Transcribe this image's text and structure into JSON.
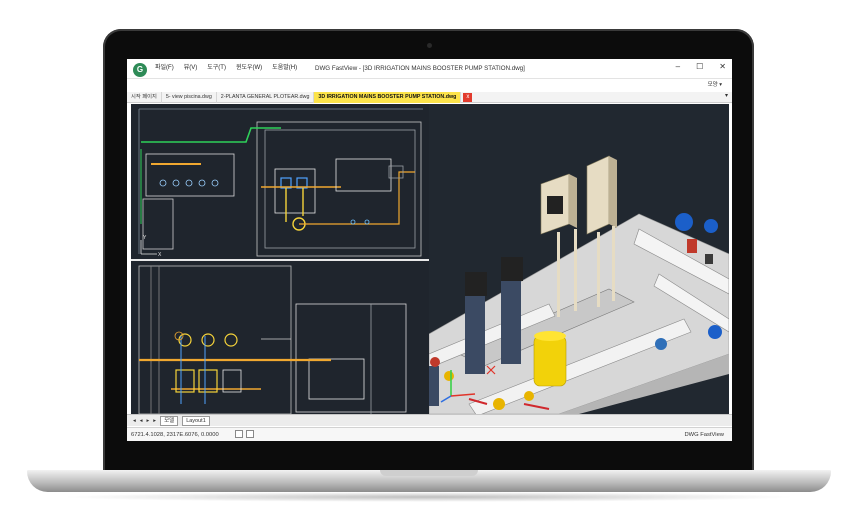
{
  "window": {
    "title": "DWG FastView - [3D IRRIGATION MAINS BOOSTER PUMP STATION.dwg]",
    "controls": [
      "–",
      "☐",
      "✕"
    ],
    "right_menu": "모양 ▾"
  },
  "menu": [
    "파일(F)",
    "뷰(V)",
    "도구(T)",
    "윈도우(W)",
    "도움말(H)"
  ],
  "tabs": [
    {
      "label": "시작 페이지"
    },
    {
      "label": "5- view piscina.dwg"
    },
    {
      "label": "2-PLANTA GENERAL PLOTEAR.dwg"
    },
    {
      "label": "3D IRRIGATION MAINS BOOSTER PUMP STATION.dwg",
      "active": true
    }
  ],
  "tab_close": "x",
  "layout": {
    "nav": [
      "◂",
      "◂",
      "▸",
      "▸"
    ],
    "tabs": [
      "모델",
      "Layout1"
    ]
  },
  "status": {
    "coords": "6721.4.1028, 2317E.6076, 0.0000",
    "app": "DWG FastView"
  },
  "colors": {
    "cad_background": "#1f252d",
    "tab_active": "#fce34a",
    "tab_close": "#e23b2e"
  }
}
